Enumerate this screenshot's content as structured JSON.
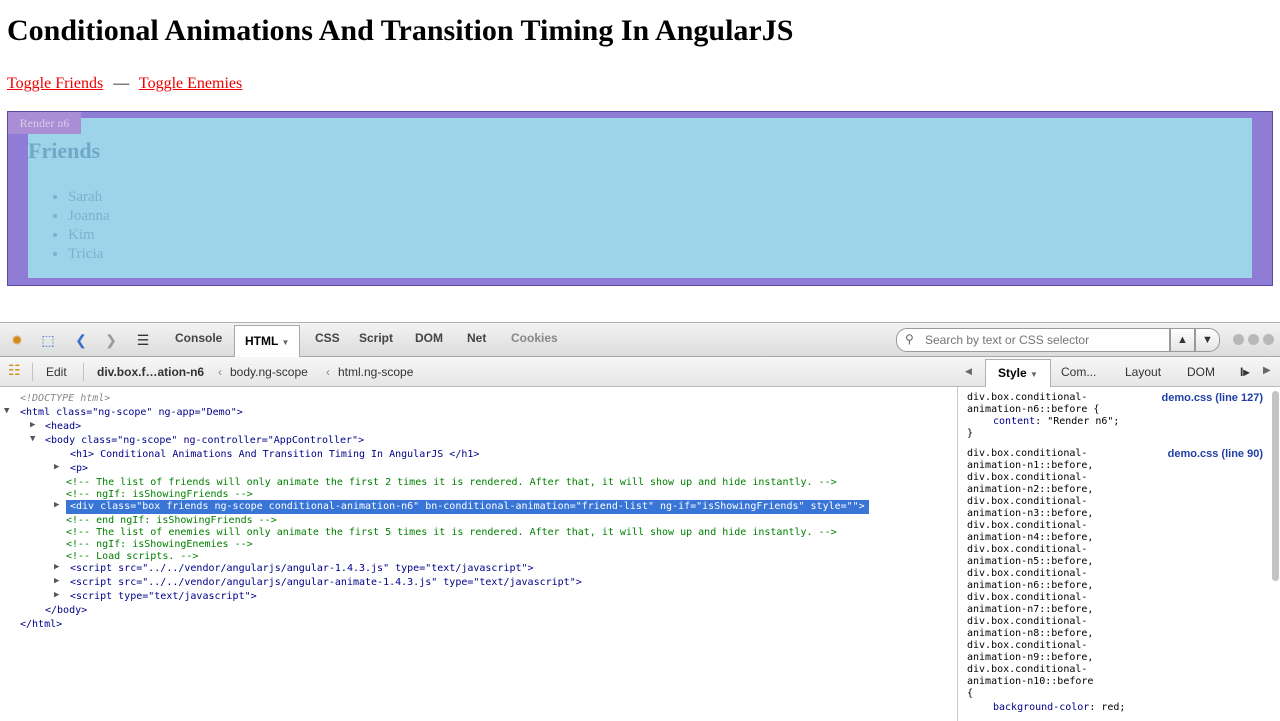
{
  "page": {
    "title": "Conditional Animations And Transition Timing In AngularJS",
    "toggle_friends": "Toggle Friends",
    "separator": "—",
    "toggle_enemies": "Toggle Enemies",
    "render_badge": "Render n6",
    "friends_heading": "Friends",
    "friends": [
      "Sarah",
      "Joanna",
      "Kim",
      "Tricia"
    ]
  },
  "devtools": {
    "tabs": [
      "Console",
      "HTML",
      "CSS",
      "Script",
      "DOM",
      "Net",
      "Cookies"
    ],
    "active_tab": "HTML",
    "search_placeholder": "Search by text or CSS selector",
    "breadcrumb": {
      "edit": "Edit",
      "items": [
        "div.box.f…ation-n6",
        "body.ng-scope",
        "html.ng-scope"
      ]
    },
    "side_tabs": [
      "Style",
      "Com...",
      "Layout",
      "DOM"
    ],
    "active_side_tab": "Style",
    "tree": {
      "doctype": "<!DOCTYPE html>",
      "html_open": "<html class=\"ng-scope\" ng-app=\"Demo\">",
      "head": "<head>",
      "body_open": "<body class=\"ng-scope\" ng-controller=\"AppController\">",
      "h1": "<h1> Conditional Animations And Transition Timing In AngularJS </h1>",
      "p": "<p>",
      "comment1": "<!-- The list of friends will only animate the first 2 times it is rendered. After that, it will show up and hide instantly. -->",
      "comment2": "<!-- ngIf: isShowingFriends -->",
      "selected": "<div class=\"box friends ng-scope conditional-animation-n6\" bn-conditional-animation=\"friend-list\" ng-if=\"isShowingFriends\" style=\"\">",
      "comment3": "<!-- end ngIf: isShowingFriends -->",
      "comment4": "<!-- The list of enemies will only animate the first 5 times it is rendered. After that, it will show up and hide instantly. -->",
      "comment5": "<!-- ngIf: isShowingEnemies -->",
      "comment6": "<!-- Load scripts. -->",
      "script1": "<script src=\"../../vendor/angularjs/angular-1.4.3.js\" type=\"text/javascript\">",
      "script2": "<script src=\"../../vendor/angularjs/angular-animate-1.4.3.js\" type=\"text/javascript\">",
      "script3": "<script type=\"text/javascript\">",
      "body_close": "</body>",
      "html_close": "</html>"
    },
    "style": {
      "rule1_selector": [
        "div.box.conditional-",
        "animation-n6::before {"
      ],
      "rule1_source": "demo.css (line 127)",
      "rule1_prop": "content",
      "rule1_value": "\"Render n6\";",
      "rule1_close": "}",
      "rule2_source": "demo.css (line 90)",
      "rule2_selector": [
        "div.box.conditional-",
        "animation-n1::before,",
        "div.box.conditional-",
        "animation-n2::before,",
        "div.box.conditional-",
        "animation-n3::before,",
        "div.box.conditional-",
        "animation-n4::before,",
        "div.box.conditional-",
        "animation-n5::before,",
        "div.box.conditional-",
        "animation-n6::before,",
        "div.box.conditional-",
        "animation-n7::before,",
        "div.box.conditional-",
        "animation-n8::before,",
        "div.box.conditional-",
        "animation-n9::before,",
        "div.box.conditional-",
        "animation-n10::before"
      ],
      "rule2_open": "{",
      "rule2_prop": "background-color",
      "rule2_value": "red;"
    }
  }
}
